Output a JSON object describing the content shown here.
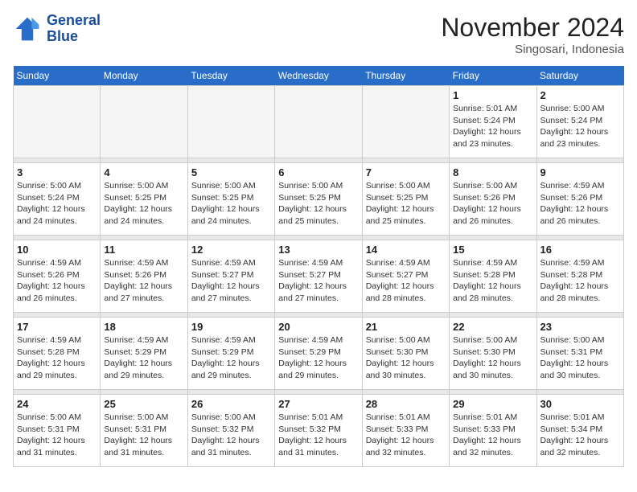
{
  "logo": {
    "line1": "General",
    "line2": "Blue"
  },
  "title": "November 2024",
  "location": "Singosari, Indonesia",
  "weekdays": [
    "Sunday",
    "Monday",
    "Tuesday",
    "Wednesday",
    "Thursday",
    "Friday",
    "Saturday"
  ],
  "weeks": [
    [
      {
        "day": "",
        "empty": true
      },
      {
        "day": "",
        "empty": true
      },
      {
        "day": "",
        "empty": true
      },
      {
        "day": "",
        "empty": true
      },
      {
        "day": "",
        "empty": true
      },
      {
        "day": "1",
        "sunrise": "5:01 AM",
        "sunset": "5:24 PM",
        "daylight": "12 hours and 23 minutes."
      },
      {
        "day": "2",
        "sunrise": "5:00 AM",
        "sunset": "5:24 PM",
        "daylight": "12 hours and 23 minutes."
      }
    ],
    [
      {
        "day": "3",
        "sunrise": "5:00 AM",
        "sunset": "5:24 PM",
        "daylight": "12 hours and 24 minutes."
      },
      {
        "day": "4",
        "sunrise": "5:00 AM",
        "sunset": "5:25 PM",
        "daylight": "12 hours and 24 minutes."
      },
      {
        "day": "5",
        "sunrise": "5:00 AM",
        "sunset": "5:25 PM",
        "daylight": "12 hours and 24 minutes."
      },
      {
        "day": "6",
        "sunrise": "5:00 AM",
        "sunset": "5:25 PM",
        "daylight": "12 hours and 25 minutes."
      },
      {
        "day": "7",
        "sunrise": "5:00 AM",
        "sunset": "5:25 PM",
        "daylight": "12 hours and 25 minutes."
      },
      {
        "day": "8",
        "sunrise": "5:00 AM",
        "sunset": "5:26 PM",
        "daylight": "12 hours and 26 minutes."
      },
      {
        "day": "9",
        "sunrise": "4:59 AM",
        "sunset": "5:26 PM",
        "daylight": "12 hours and 26 minutes."
      }
    ],
    [
      {
        "day": "10",
        "sunrise": "4:59 AM",
        "sunset": "5:26 PM",
        "daylight": "12 hours and 26 minutes."
      },
      {
        "day": "11",
        "sunrise": "4:59 AM",
        "sunset": "5:26 PM",
        "daylight": "12 hours and 27 minutes."
      },
      {
        "day": "12",
        "sunrise": "4:59 AM",
        "sunset": "5:27 PM",
        "daylight": "12 hours and 27 minutes."
      },
      {
        "day": "13",
        "sunrise": "4:59 AM",
        "sunset": "5:27 PM",
        "daylight": "12 hours and 27 minutes."
      },
      {
        "day": "14",
        "sunrise": "4:59 AM",
        "sunset": "5:27 PM",
        "daylight": "12 hours and 28 minutes."
      },
      {
        "day": "15",
        "sunrise": "4:59 AM",
        "sunset": "5:28 PM",
        "daylight": "12 hours and 28 minutes."
      },
      {
        "day": "16",
        "sunrise": "4:59 AM",
        "sunset": "5:28 PM",
        "daylight": "12 hours and 28 minutes."
      }
    ],
    [
      {
        "day": "17",
        "sunrise": "4:59 AM",
        "sunset": "5:28 PM",
        "daylight": "12 hours and 29 minutes."
      },
      {
        "day": "18",
        "sunrise": "4:59 AM",
        "sunset": "5:29 PM",
        "daylight": "12 hours and 29 minutes."
      },
      {
        "day": "19",
        "sunrise": "4:59 AM",
        "sunset": "5:29 PM",
        "daylight": "12 hours and 29 minutes."
      },
      {
        "day": "20",
        "sunrise": "4:59 AM",
        "sunset": "5:29 PM",
        "daylight": "12 hours and 29 minutes."
      },
      {
        "day": "21",
        "sunrise": "5:00 AM",
        "sunset": "5:30 PM",
        "daylight": "12 hours and 30 minutes."
      },
      {
        "day": "22",
        "sunrise": "5:00 AM",
        "sunset": "5:30 PM",
        "daylight": "12 hours and 30 minutes."
      },
      {
        "day": "23",
        "sunrise": "5:00 AM",
        "sunset": "5:31 PM",
        "daylight": "12 hours and 30 minutes."
      }
    ],
    [
      {
        "day": "24",
        "sunrise": "5:00 AM",
        "sunset": "5:31 PM",
        "daylight": "12 hours and 31 minutes."
      },
      {
        "day": "25",
        "sunrise": "5:00 AM",
        "sunset": "5:31 PM",
        "daylight": "12 hours and 31 minutes."
      },
      {
        "day": "26",
        "sunrise": "5:00 AM",
        "sunset": "5:32 PM",
        "daylight": "12 hours and 31 minutes."
      },
      {
        "day": "27",
        "sunrise": "5:01 AM",
        "sunset": "5:32 PM",
        "daylight": "12 hours and 31 minutes."
      },
      {
        "day": "28",
        "sunrise": "5:01 AM",
        "sunset": "5:33 PM",
        "daylight": "12 hours and 32 minutes."
      },
      {
        "day": "29",
        "sunrise": "5:01 AM",
        "sunset": "5:33 PM",
        "daylight": "12 hours and 32 minutes."
      },
      {
        "day": "30",
        "sunrise": "5:01 AM",
        "sunset": "5:34 PM",
        "daylight": "12 hours and 32 minutes."
      }
    ]
  ]
}
